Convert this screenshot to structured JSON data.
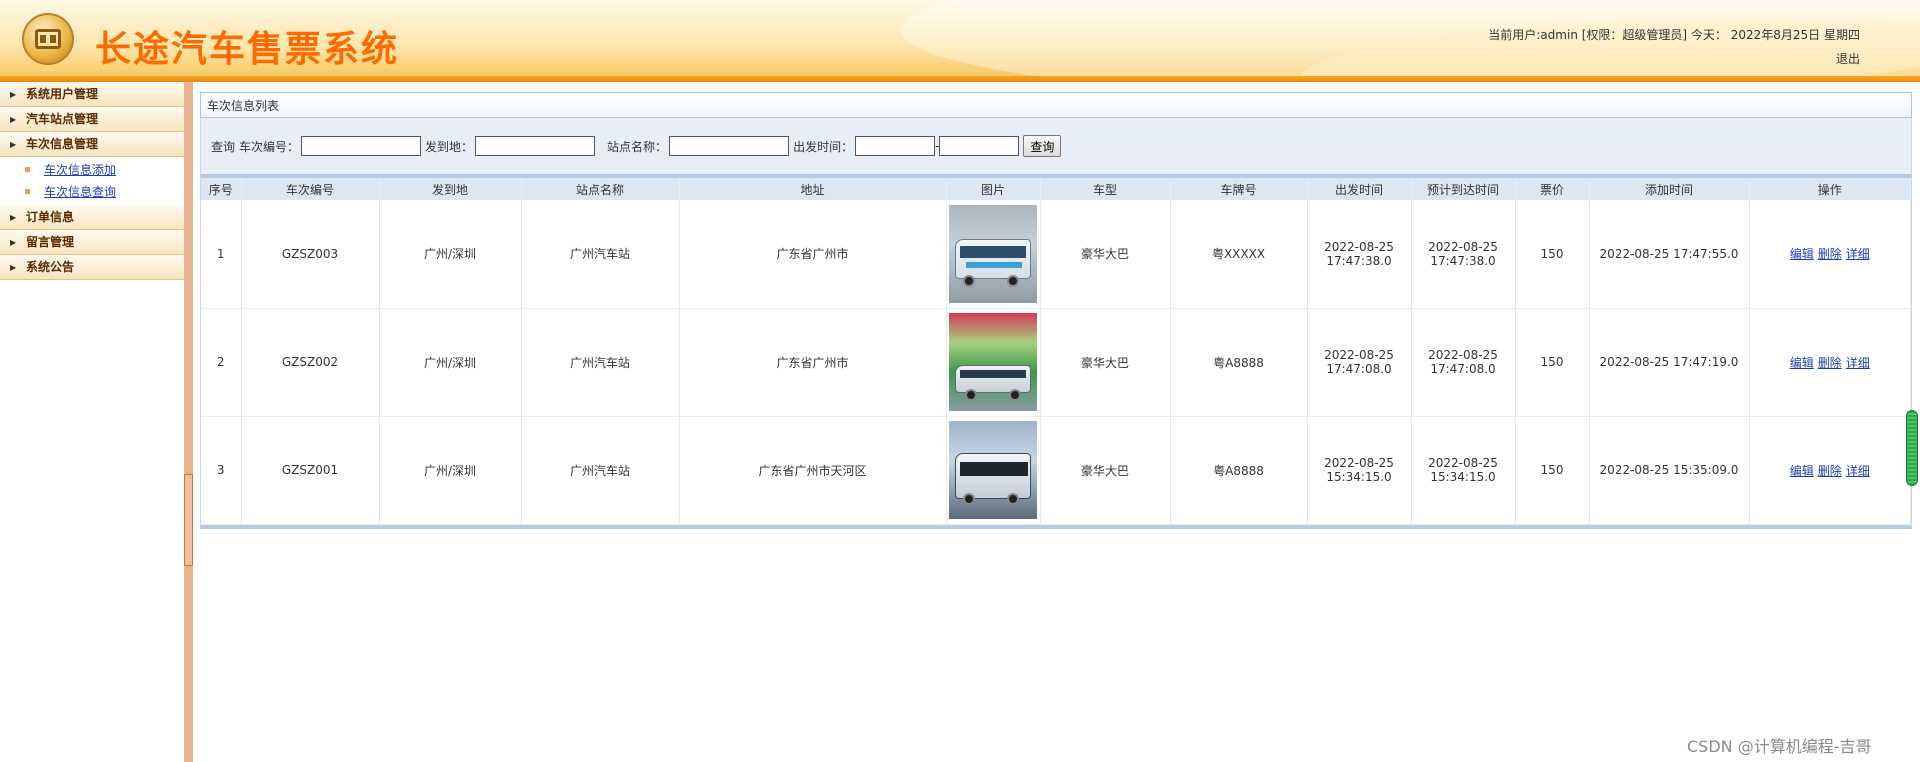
{
  "header": {
    "title": "长途汽车售票系统",
    "user_info": "当前用户:admin [权限：超级管理员] 今天：  2022年8月25日 星期四",
    "logout_label": "退出"
  },
  "sidebar": {
    "sections": [
      {
        "label": "系统用户管理"
      },
      {
        "label": "汽车站点管理"
      },
      {
        "label": "车次信息管理",
        "items": [
          "车次信息添加",
          "车次信息查询"
        ]
      },
      {
        "label": "订单信息"
      },
      {
        "label": "留言管理"
      },
      {
        "label": "系统公告"
      }
    ]
  },
  "main": {
    "panel_title": "车次信息列表",
    "search": {
      "query_label": "查询",
      "train_no_label": "车次编号：",
      "origin_dest_label": "发到地：",
      "station_label": "站点名称：",
      "depart_time_label": "出发时间：",
      "range_separator": "-",
      "search_button": "查询",
      "train_no_value": "",
      "origin_dest_value": "",
      "station_value": "",
      "depart_from_value": "",
      "depart_to_value": ""
    },
    "table": {
      "columns": [
        "序号",
        "车次编号",
        "发到地",
        "站点名称",
        "地址",
        "图片",
        "车型",
        "车牌号",
        "出发时间",
        "预计到达时间",
        "票价",
        "添加时间",
        "操作"
      ],
      "rows": [
        {
          "no": "1",
          "train_no": "GZSZ003",
          "route": "广州/深圳",
          "station": "广州汽车站",
          "address": "广东省广州市",
          "image": "bus-photo-1",
          "bus_type": "豪华大巴",
          "plate": "粤XXXXX",
          "depart_date": "2022-08-25",
          "depart_time": "17:47:38.0",
          "arrive_date": "2022-08-25",
          "arrive_time": "17:47:38.0",
          "price": "150",
          "added": "2022-08-25 17:47:55.0"
        },
        {
          "no": "2",
          "train_no": "GZSZ002",
          "route": "广州/深圳",
          "station": "广州汽车站",
          "address": "广东省广州市",
          "image": "bus-photo-2",
          "bus_type": "豪华大巴",
          "plate": "粤A8888",
          "depart_date": "2022-08-25",
          "depart_time": "17:47:08.0",
          "arrive_date": "2022-08-25",
          "arrive_time": "17:47:08.0",
          "price": "150",
          "added": "2022-08-25 17:47:19.0"
        },
        {
          "no": "3",
          "train_no": "GZSZ001",
          "route": "广州/深圳",
          "station": "广州汽车站",
          "address": "广东省广州市天河区",
          "image": "bus-photo-3",
          "bus_type": "豪华大巴",
          "plate": "粤A8888",
          "depart_date": "2022-08-25",
          "depart_time": "15:34:15.0",
          "arrive_date": "2022-08-25",
          "arrive_time": "15:34:15.0",
          "price": "150",
          "added": "2022-08-25 15:35:09.0"
        }
      ],
      "actions": {
        "edit": "编辑",
        "delete": "删除",
        "detail": "详细"
      }
    }
  },
  "watermark": "CSDN @计算机编程-吉哥"
}
